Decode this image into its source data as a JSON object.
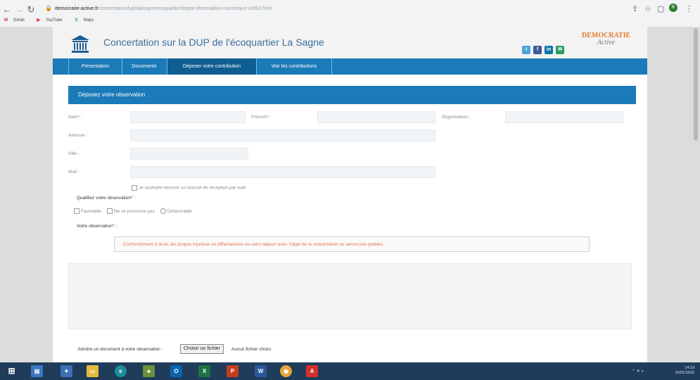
{
  "browser": {
    "host": "democratie-active.fr",
    "path": "/concertationdupmlasagneecoquartier/depot-observation-numerique-v1802.html",
    "bookmarks": [
      {
        "icon": "M",
        "label": "Gmail",
        "color": "#d93025"
      },
      {
        "icon": "▶",
        "label": "YouTube",
        "color": "#e62117"
      },
      {
        "icon": "⚲",
        "label": "Maps",
        "color": "#34a853"
      }
    ],
    "avatar_letter": "R"
  },
  "site": {
    "title": "Concertation sur la DUP de l'écoquartier La Sagne",
    "brand_line1": "DEMOCRATIE",
    "brand_line2": "Active",
    "social": [
      {
        "name": "twitter",
        "glyph": "t",
        "color": "#4aa6d8"
      },
      {
        "name": "facebook",
        "glyph": "f",
        "color": "#3b5998"
      },
      {
        "name": "linkedin",
        "glyph": "in",
        "color": "#0e76a8"
      },
      {
        "name": "email",
        "glyph": "✉",
        "color": "#2a9d64"
      }
    ]
  },
  "nav": {
    "tabs": [
      "Présentation",
      "Documents",
      "Déposer votre contribution",
      "Voir les contributions"
    ],
    "active": 2
  },
  "form": {
    "heading": "Déposez votre observation",
    "nom_label": "Nom* :",
    "prenom_label": "Prenom* :",
    "organisation_label": "Organisation :",
    "adresse_label": "Adresse :",
    "ville_label": "Ville :",
    "mail_label": "Mail :",
    "receipt_label": "Je souhaite recevoir un accusé de réception par mail",
    "qualify_label": "Qualifiez votre observation* :",
    "options": [
      "Favorable",
      "Ne se prononce pas",
      "Défavorable"
    ],
    "observation_label": "Votre observation* :",
    "notice": "Conformément à la loi, les propos injurieux ou diffamatoires ou sans rapport avec l'objet de la concertation ne seront pas publiés.",
    "attach_label": "Joindre un document à votre observation :",
    "file_button": "Choisir un fichier",
    "file_status": "Aucun fichier choisi"
  },
  "taskbar": {
    "apps": [
      {
        "name": "start",
        "glyph": "⊞",
        "color": "#1f3c5a"
      },
      {
        "name": "file-manager",
        "glyph": "▤",
        "color": "#3a78c2"
      },
      {
        "name": "pinned-app",
        "glyph": "✦",
        "color": "#3c6fb5"
      },
      {
        "name": "file-explorer",
        "glyph": "▭",
        "color": "#e6b93f"
      },
      {
        "name": "edge",
        "glyph": "e",
        "color": "#1d8f9c"
      },
      {
        "name": "app",
        "glyph": "♣",
        "color": "#6b8f3a"
      },
      {
        "name": "outlook",
        "glyph": "O",
        "color": "#0a64ad"
      },
      {
        "name": "excel",
        "glyph": "X",
        "color": "#1e7145"
      },
      {
        "name": "powerpoint",
        "glyph": "P",
        "color": "#c43e1c"
      },
      {
        "name": "word",
        "glyph": "W",
        "color": "#2b579a"
      },
      {
        "name": "chrome",
        "glyph": "◉",
        "color": "#e8a33d"
      },
      {
        "name": "acrobat",
        "glyph": "A",
        "color": "#d42d2d"
      }
    ],
    "time": "14:19",
    "date": "10/01/2022"
  }
}
